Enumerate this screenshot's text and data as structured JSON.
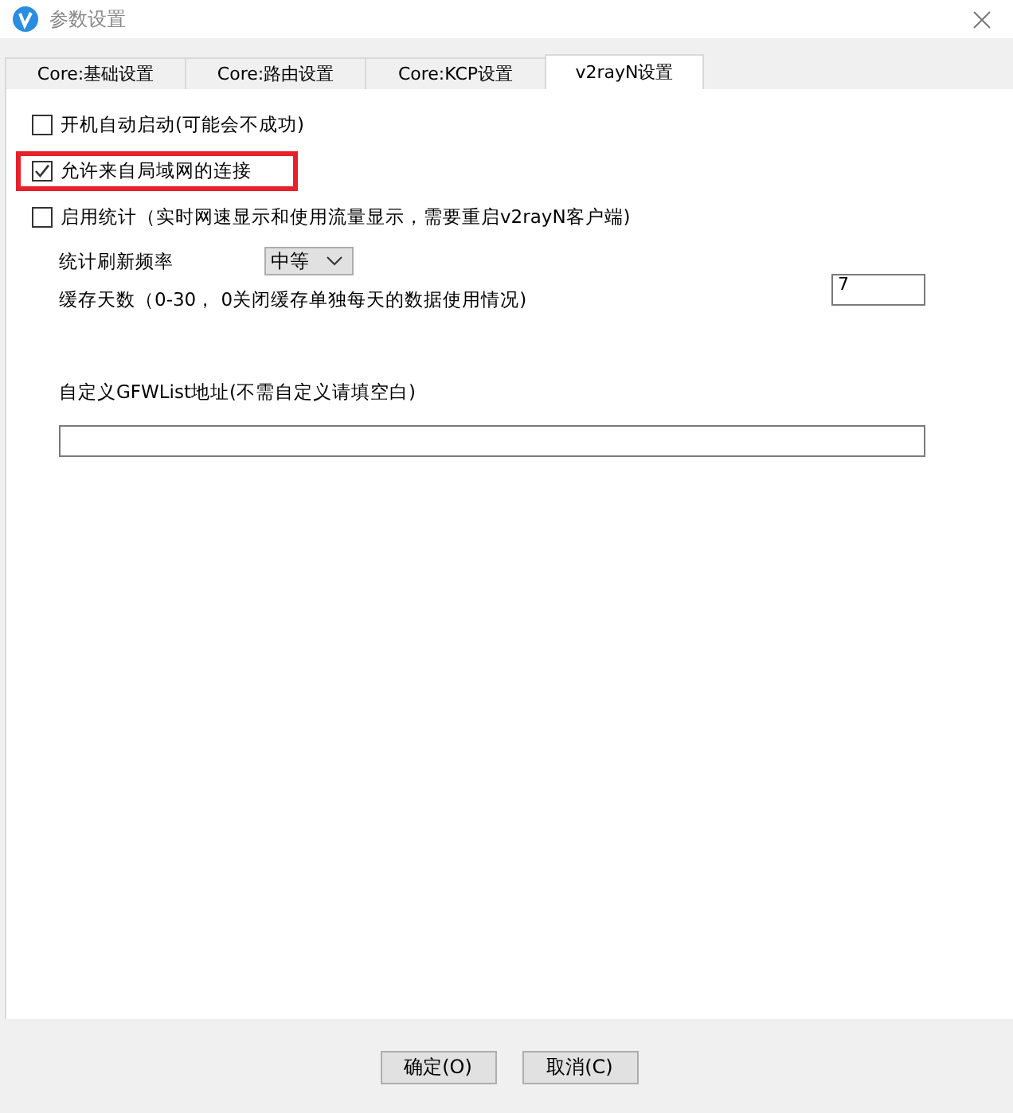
{
  "window": {
    "title": "参数设置"
  },
  "tabs": [
    {
      "label": "Core:基础设置",
      "selected": false
    },
    {
      "label": "Core:路由设置",
      "selected": false
    },
    {
      "label": "Core:KCP设置",
      "selected": false
    },
    {
      "label": "v2rayN设置",
      "selected": true
    }
  ],
  "options": [
    {
      "label": "开机自动启动(可能会不成功)",
      "checked": false,
      "highlighted": false
    },
    {
      "label": "允许来自局域网的连接",
      "checked": true,
      "highlighted": true
    },
    {
      "label": "启用统计（实时网速显示和使用流量显示，需要重启v2rayN客户端)",
      "checked": false,
      "highlighted": false
    }
  ],
  "refresh_rate": {
    "label": "统计刷新频率",
    "value": "中等"
  },
  "cache_days": {
    "label": "缓存天数（0-30， 0关闭缓存单独每天的数据使用情况)",
    "value": "7"
  },
  "gfwlist": {
    "label": "自定义GFWList地址(不需自定义请填空白)"
  },
  "buttons": [
    "确定(O)",
    "取消(C)"
  ]
}
